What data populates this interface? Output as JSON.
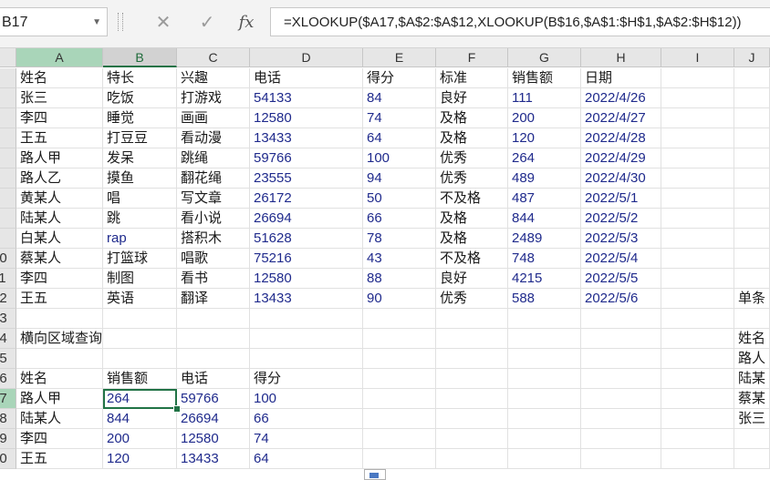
{
  "formula_bar": {
    "name_box": "B17",
    "cancel_glyph": "✕",
    "enter_glyph": "✓",
    "fx_glyph": "fx",
    "formula": "=XLOOKUP($A17,$A$2:$A$12,XLOOKUP(B$16,$A$1:$H$1,$A$2:$H$12))"
  },
  "columns": [
    "A",
    "B",
    "C",
    "D",
    "E",
    "F",
    "G",
    "H",
    "I",
    "J"
  ],
  "rows": [
    "1",
    "2",
    "3",
    "4",
    "5",
    "6",
    "7",
    "8",
    "9",
    "10",
    "11",
    "12",
    "13",
    "14",
    "15",
    "16",
    "17",
    "18",
    "19",
    "20"
  ],
  "header_row": [
    "姓名",
    "特长",
    "兴趣",
    "电话",
    "得分",
    "标准",
    "销售额",
    "日期"
  ],
  "table": [
    [
      "张三",
      "吃饭",
      "打游戏",
      "54133",
      "84",
      "良好",
      "111",
      "2022/4/26"
    ],
    [
      "李四",
      "睡觉",
      "画画",
      "12580",
      "74",
      "及格",
      "200",
      "2022/4/27"
    ],
    [
      "王五",
      "打豆豆",
      "看动漫",
      "13433",
      "64",
      "及格",
      "120",
      "2022/4/28"
    ],
    [
      " 路人甲",
      "发呆",
      "跳绳",
      "59766",
      "100",
      "优秀",
      "264",
      "2022/4/29"
    ],
    [
      "路人乙",
      "摸鱼",
      "翻花绳",
      "23555",
      "94",
      "优秀",
      "489",
      "2022/4/30"
    ],
    [
      "黄某人",
      "唱",
      "写文章",
      "26172",
      "50",
      "不及格",
      "487",
      "2022/5/1"
    ],
    [
      "陆某人",
      "跳",
      "看小说",
      "26694",
      "66",
      "及格",
      "844",
      "2022/5/2"
    ],
    [
      "白某人",
      "rap",
      "搭积木",
      "51628",
      "78",
      "及格",
      "2489",
      "2022/5/3"
    ],
    [
      "蔡某人",
      "打篮球",
      "唱歌",
      "75216",
      "43",
      "不及格",
      "748",
      "2022/5/4"
    ],
    [
      "李四",
      "制图",
      "看书",
      "12580",
      "88",
      "良好",
      "4215",
      "2022/5/5"
    ],
    [
      "王五",
      "英语",
      "翻译",
      "13433",
      "90",
      "优秀",
      "588",
      "2022/5/6"
    ]
  ],
  "side_label_row12": "单条",
  "section_title": "横向区域查询",
  "query_headers": [
    "姓名",
    "销售额",
    "电话",
    "得分"
  ],
  "query_rows": [
    [
      " 路人甲",
      "264",
      "59766",
      "100"
    ],
    [
      "陆某人",
      "844",
      "26694",
      "66"
    ],
    [
      "李四",
      "200",
      "12580",
      "74"
    ],
    [
      "王五",
      "120",
      "13433",
      "64"
    ]
  ],
  "side_column_j": [
    "姓名",
    " 路人",
    "陆某",
    "蔡某",
    "张三"
  ]
}
